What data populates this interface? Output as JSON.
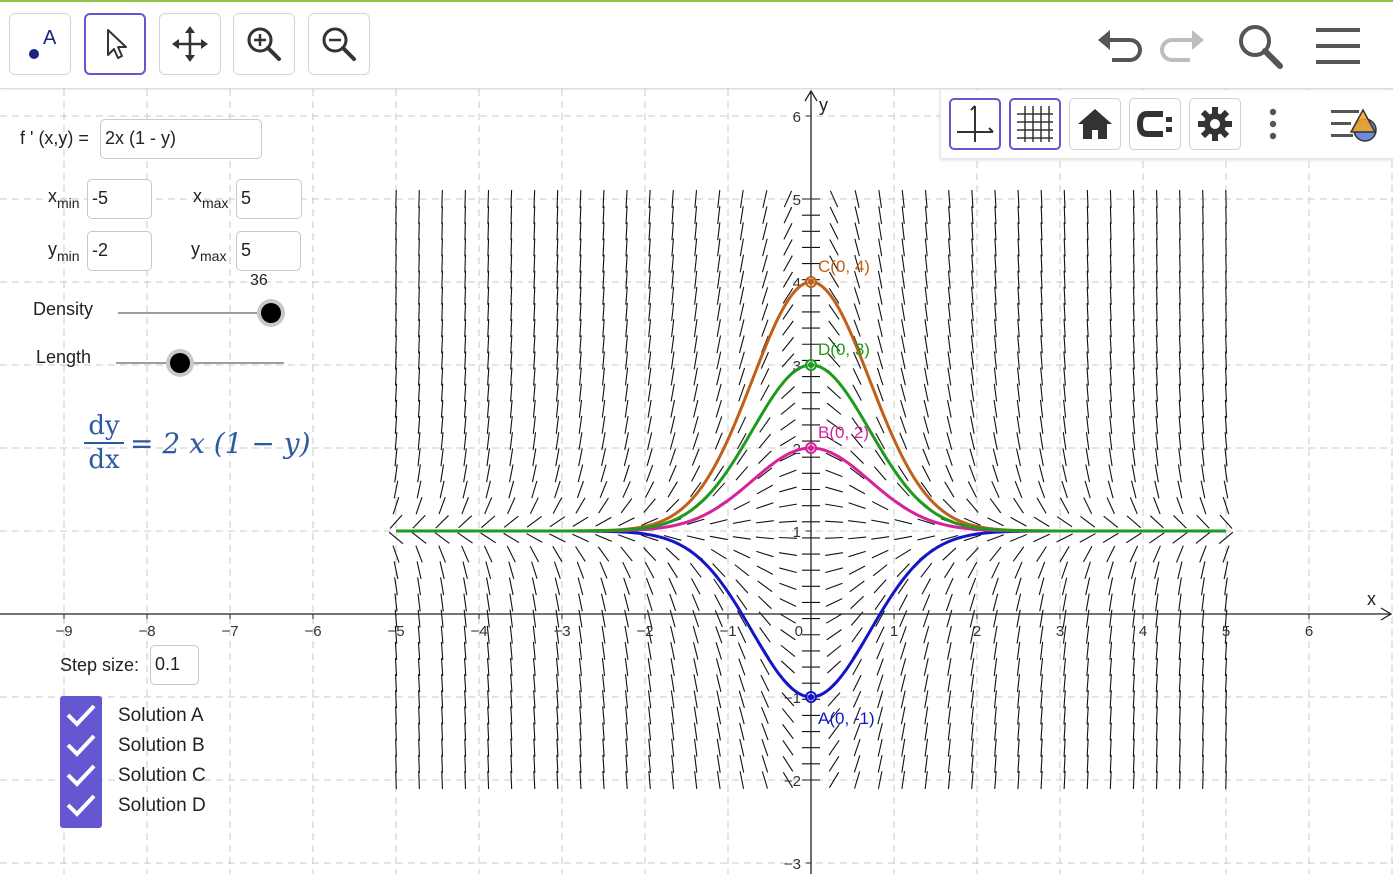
{
  "toolbar": {
    "tools": [
      {
        "name": "point-tool",
        "label": "A"
      },
      {
        "name": "move-tool"
      },
      {
        "name": "move-graphics-view-tool"
      },
      {
        "name": "zoom-in-tool"
      },
      {
        "name": "zoom-out-tool"
      }
    ],
    "right": [
      "undo-icon",
      "redo-icon",
      "search-icon",
      "menu-icon"
    ]
  },
  "graphics_style_bar": [
    "axes-toggle",
    "grid-toggle",
    "home-view",
    "capture-icon",
    "settings-icon",
    "more-icon",
    "style-bar-toggle"
  ],
  "panel": {
    "fprime_label": "f ' (x,y) =",
    "fprime_value": "2x (1 - y)",
    "xmin_label": "x",
    "xmin_sub": "min",
    "xmin_value": "-5",
    "xmax_label": "x",
    "xmax_sub": "max",
    "xmax_value": "5",
    "ymin_label": "y",
    "ymin_sub": "min",
    "ymin_value": "-2",
    "ymax_label": "y",
    "ymax_sub": "max",
    "ymax_value": "5",
    "density_label": "Density",
    "density_value": "36",
    "length_label": "Length",
    "length_level": 0.38,
    "density_level": 1.0,
    "equation_lhs_num": "dy",
    "equation_lhs_den": "dx",
    "equation_rhs": "= 2 x (1 − y)",
    "step_label": "Step size:",
    "step_value": "0.1",
    "solutions": [
      {
        "label": "Solution A",
        "checked": true
      },
      {
        "label": "Solution B",
        "checked": true
      },
      {
        "label": "Solution C",
        "checked": true
      },
      {
        "label": "Solution D",
        "checked": true
      }
    ]
  },
  "chart_data": {
    "type": "line",
    "xlabel": "x",
    "ylabel": "y",
    "xlim": [
      -9.8,
      7
    ],
    "ylim": [
      -3,
      6.3
    ],
    "grid": true,
    "x_ticks": [
      -9,
      -8,
      -7,
      -6,
      -5,
      -4,
      -3,
      -2,
      -1,
      0,
      1,
      2,
      3,
      4,
      5,
      6
    ],
    "y_ticks": [
      -3,
      -2,
      -1,
      1,
      2,
      3,
      4,
      5,
      6
    ],
    "slope_field": {
      "expression": "2x (1 - y)",
      "x_range": [
        -5,
        5
      ],
      "y_range": [
        -2,
        5
      ],
      "density": 36
    },
    "series": [
      {
        "name": "A",
        "color": "#1515c8",
        "initial": [
          0,
          -1
        ]
      },
      {
        "name": "B",
        "color": "#d6239b",
        "initial": [
          0,
          2
        ]
      },
      {
        "name": "C",
        "color": "#c0601a",
        "initial": [
          0,
          4
        ]
      },
      {
        "name": "D",
        "color": "#1e9a1e",
        "initial": [
          0,
          3
        ]
      }
    ],
    "points": [
      {
        "label": "A(0, -1)",
        "x": 0,
        "y": -1,
        "color": "#1515c8"
      },
      {
        "label": "B(0, 2)",
        "x": 0,
        "y": 2,
        "color": "#d6239b"
      },
      {
        "label": "C(0, 4)",
        "x": 0,
        "y": 4,
        "color": "#c0601a"
      },
      {
        "label": "D(0, 3)",
        "x": 0,
        "y": 3,
        "color": "#1e9a1e"
      }
    ]
  }
}
